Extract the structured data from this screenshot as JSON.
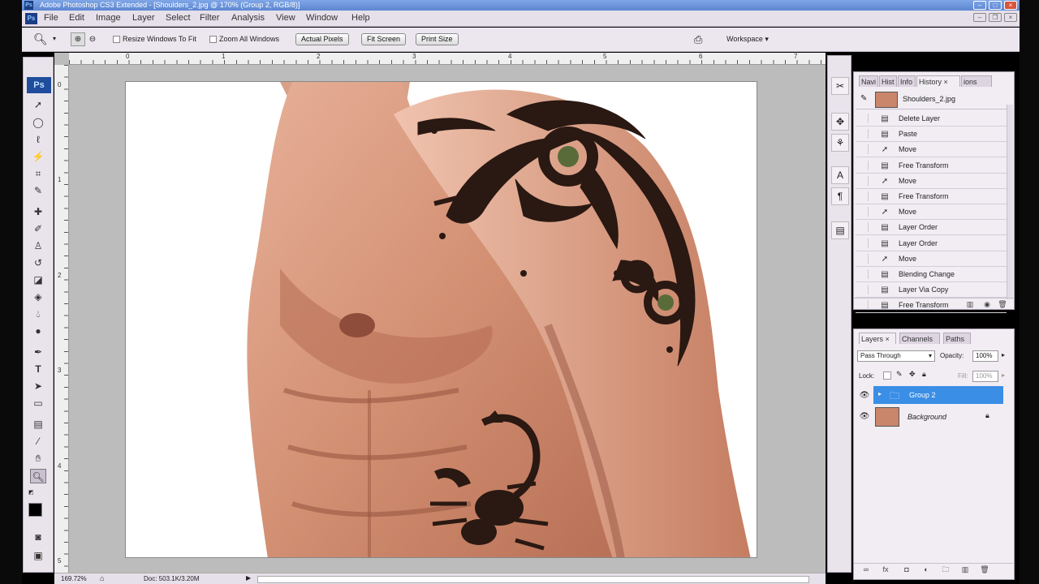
{
  "window": {
    "title": "Adobe Photoshop CS3 Extended - [Shoulders_2.jpg @ 170% (Group 2, RGB/8)]",
    "app_badge": "Ps"
  },
  "menu": [
    "File",
    "Edit",
    "Image",
    "Layer",
    "Select",
    "Filter",
    "Analysis",
    "View",
    "Window",
    "Help"
  ],
  "options_bar": {
    "resize_windows_label": "Resize Windows To Fit",
    "zoom_all_windows_label": "Zoom All Windows",
    "actual_pixels": "Actual Pixels",
    "fit_screen": "Fit Screen",
    "print_size": "Print Size",
    "workspace": "Workspace ▾"
  },
  "ruler": {
    "top_ticks": [
      "0",
      "1",
      "2",
      "3",
      "4",
      "5",
      "6",
      "7"
    ],
    "left_ticks": [
      "0",
      "1",
      "2",
      "3",
      "4",
      "5"
    ]
  },
  "history_panel": {
    "tabs": [
      "Navi",
      "Hist",
      "Info",
      "History ×",
      "ions"
    ],
    "snapshot": "Shoulders_2.jpg",
    "items": [
      {
        "label": "Delete Layer",
        "icon": "doc"
      },
      {
        "label": "Paste",
        "icon": "doc"
      },
      {
        "label": "Move",
        "icon": "move"
      },
      {
        "label": "Free Transform",
        "icon": "doc"
      },
      {
        "label": "Move",
        "icon": "move"
      },
      {
        "label": "Free Transform",
        "icon": "doc"
      },
      {
        "label": "Move",
        "icon": "move"
      },
      {
        "label": "Layer Order",
        "icon": "doc"
      },
      {
        "label": "Layer Order",
        "icon": "doc"
      },
      {
        "label": "Move",
        "icon": "move"
      },
      {
        "label": "Blending Change",
        "icon": "doc"
      },
      {
        "label": "Layer Via Copy",
        "icon": "doc"
      },
      {
        "label": "Free Transform",
        "icon": "doc"
      }
    ]
  },
  "layers_panel": {
    "tabs": [
      "Layers ×",
      "Channels",
      "Paths"
    ],
    "blend_mode": "Pass Through",
    "opacity_label": "Opacity:",
    "opacity_value": "100%",
    "lock_label": "Lock:",
    "fill_label": "Fill:",
    "fill_value": "100%",
    "layers": [
      {
        "name": "Group 2",
        "selected": true
      },
      {
        "name": "Background",
        "selected": false
      }
    ]
  },
  "status": {
    "zoom": "169.72%",
    "doc": "Doc: 503.1K/3.20M"
  },
  "colors": {
    "selection": "#3a8ee6",
    "canvas_bg": "#bcbcbc"
  }
}
